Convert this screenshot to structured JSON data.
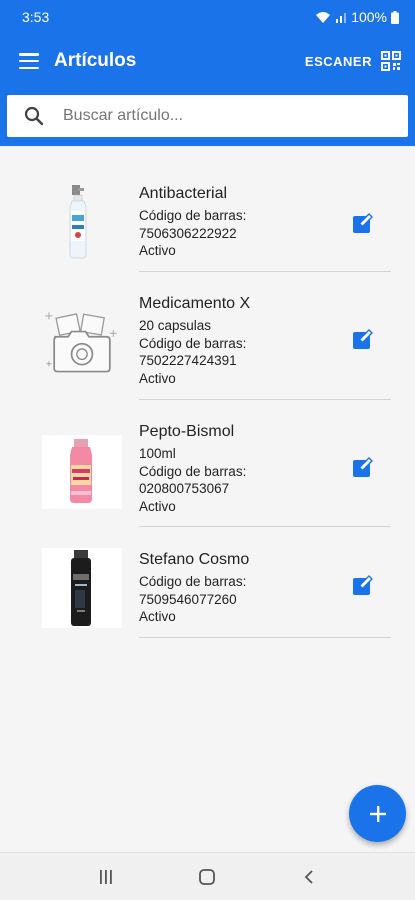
{
  "status_bar": {
    "time": "3:53",
    "battery": "100%"
  },
  "app_bar": {
    "title": "Artículos",
    "scanner_label": "ESCANER"
  },
  "search": {
    "placeholder": "Buscar artículo..."
  },
  "items": [
    {
      "name": "Antibacterial",
      "lines": [
        "Código de barras:",
        "7506306222922",
        "Activo"
      ],
      "image": "spray-bottle"
    },
    {
      "name": "Medicamento X",
      "lines": [
        "20 capsulas",
        "Código de barras:",
        "7502227424391",
        "Activo"
      ],
      "image": "photo-placeholder"
    },
    {
      "name": "Pepto-Bismol",
      "lines": [
        "100ml",
        "Código de barras:",
        "020800753067",
        "Activo"
      ],
      "image": "pink-bottle"
    },
    {
      "name": "Stefano Cosmo",
      "lines": [
        "Código de barras:",
        "7509546077260",
        "Activo"
      ],
      "image": "black-can"
    }
  ],
  "icons": {
    "menu": "menu-icon",
    "qr": "qr-code-icon",
    "search": "search-icon",
    "edit": "edit-icon",
    "add": "plus-icon"
  },
  "colors": {
    "primary": "#1a73e8",
    "background": "#f5f5f5"
  }
}
